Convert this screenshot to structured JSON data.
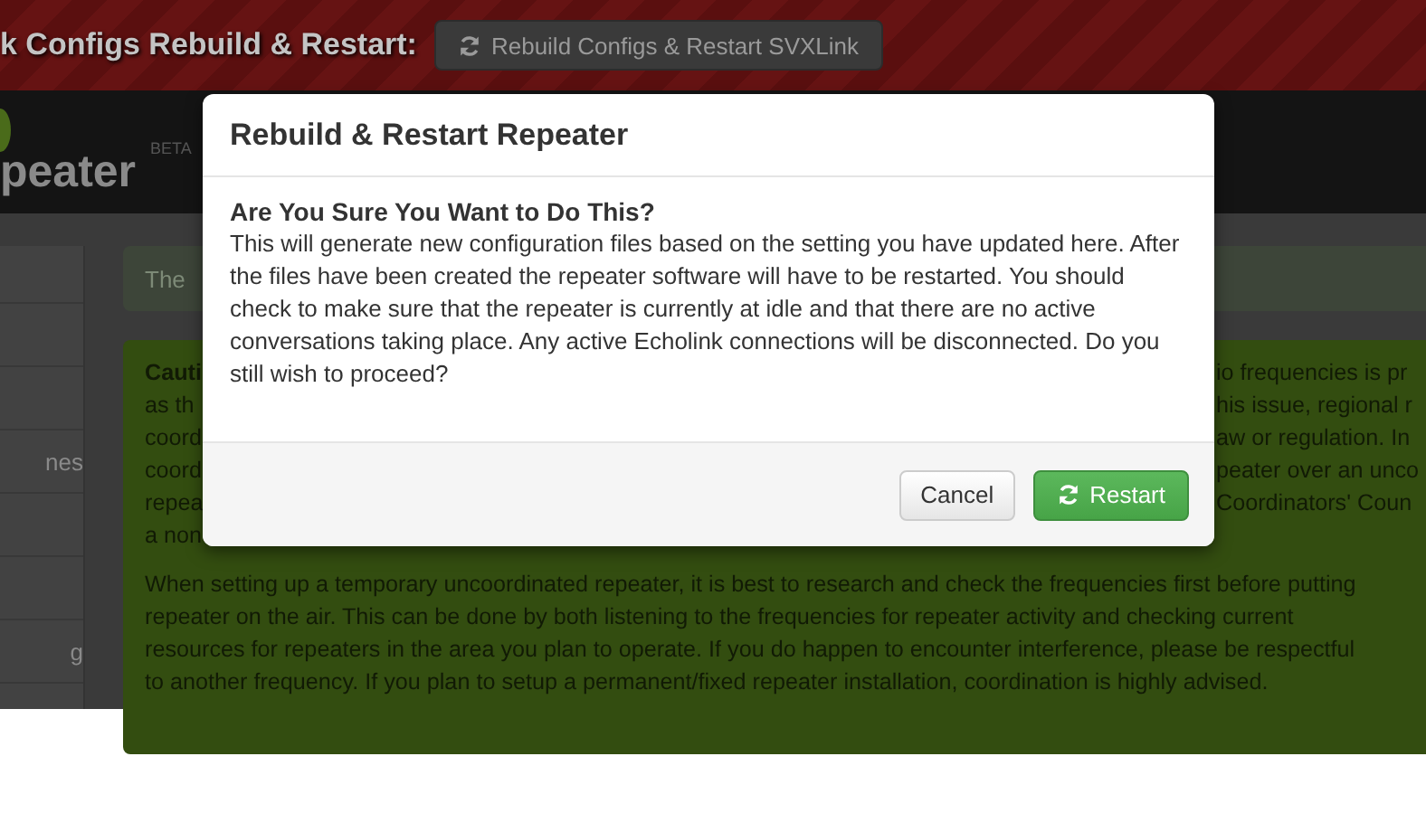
{
  "top_bar": {
    "heading": "k Configs Rebuild & Restart:",
    "button": "Rebuild Configs & Restart SVXLink"
  },
  "header": {
    "logo_text": "peater",
    "badge": "BETA"
  },
  "sidebar": {
    "items": [
      {
        "label": "nes"
      },
      {
        "label": "g"
      }
    ]
  },
  "alert": {
    "text": "The"
  },
  "caution_box": {
    "rows": [
      {
        "left": "Cauti",
        "right": "io frequencies is pr"
      },
      {
        "left": "as th",
        "right": "his issue, regional r"
      },
      {
        "left": "coord",
        "right": "aw or regulation. In"
      },
      {
        "left": "coord",
        "right": "peater over an unco"
      },
      {
        "left": "repea",
        "right": "Coordinators' Coun"
      },
      {
        "left": "a non"
      }
    ],
    "paragraph_lines": [
      "When setting up a temporary uncoordinated repeater, it is best to research and check the frequencies first before putting",
      "repeater on the air. This can be done by both listening to the frequencies for repeater activity and checking current",
      "resources for repeaters in the area you plan to operate. If you do happen to encounter interference, please be respectful",
      "to another frequency. If you plan to setup a permanent/fixed repeater installation, coordination is highly advised."
    ]
  },
  "modal": {
    "title": "Rebuild & Restart Repeater",
    "question": "Are You Sure You Want to Do This?",
    "message": "This will generate new configuration files based on the setting you have updated here. After the files have been created the repeater software will have to be restarted. You should check to make sure that the repeater is currently at idle and that there are no active conversations taking place. Any active Echolink connections will be disconnected. Do you still wish to proceed?",
    "buttons": [
      {
        "label": "Cancel",
        "kind": "default"
      },
      {
        "label": "Restart",
        "kind": "primary"
      }
    ]
  }
}
